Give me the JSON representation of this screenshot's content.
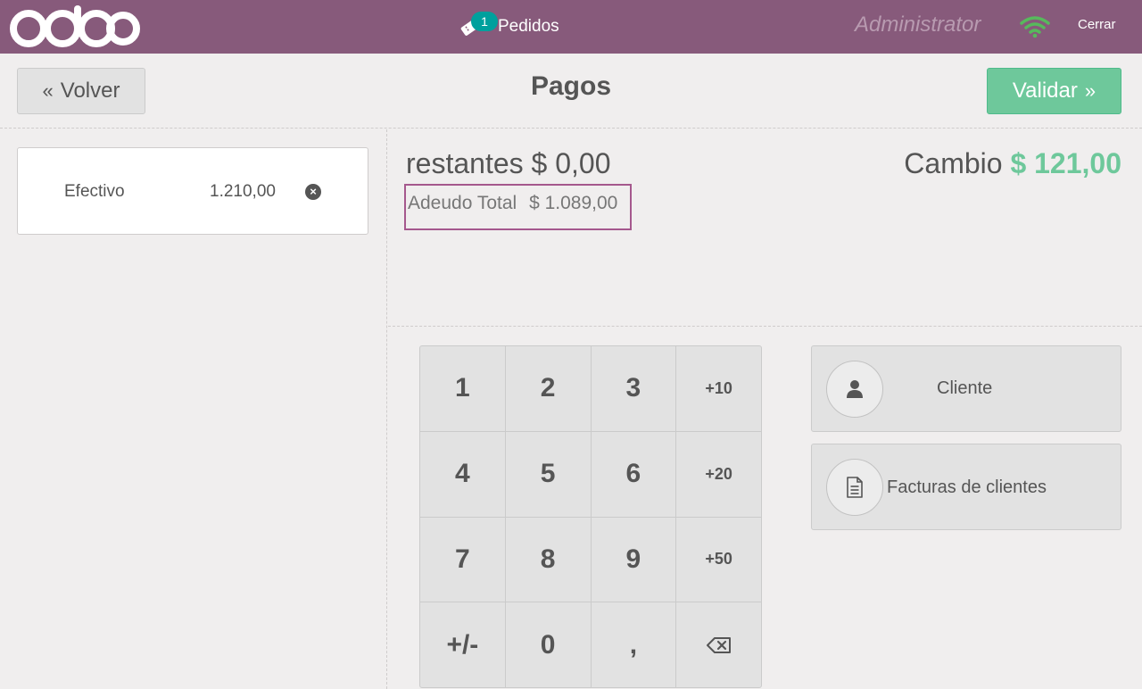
{
  "topbar": {
    "logo_text": "odoo",
    "orders_count": "1",
    "orders_label": "Pedidos",
    "user": "Administrator",
    "close_label": "Cerrar"
  },
  "header": {
    "back_label": "Volver",
    "title": "Pagos",
    "validate_label": "Validar"
  },
  "payment_lines": [
    {
      "method": "Efectivo",
      "amount": "1.210,00"
    }
  ],
  "summary": {
    "remaining_label": "restantes",
    "remaining_value": "$ 0,00",
    "change_label": "Cambio",
    "change_value": "$ 121,00",
    "total_due_label": "Adeudo Total",
    "total_due_value": "$ 1.089,00"
  },
  "numpad": {
    "keys": [
      "1",
      "2",
      "3",
      "+10",
      "4",
      "5",
      "6",
      "+20",
      "7",
      "8",
      "9",
      "+50",
      "+/-",
      "0",
      ",",
      "⌫"
    ]
  },
  "actions": {
    "client_label": "Cliente",
    "invoice_label": "Facturas de clientes"
  },
  "colors": {
    "topbar": "#875a7b",
    "validate": "#6ec89b",
    "badge": "#00a09d",
    "wifi": "#57b95c",
    "highlight_border": "#a5588d"
  }
}
